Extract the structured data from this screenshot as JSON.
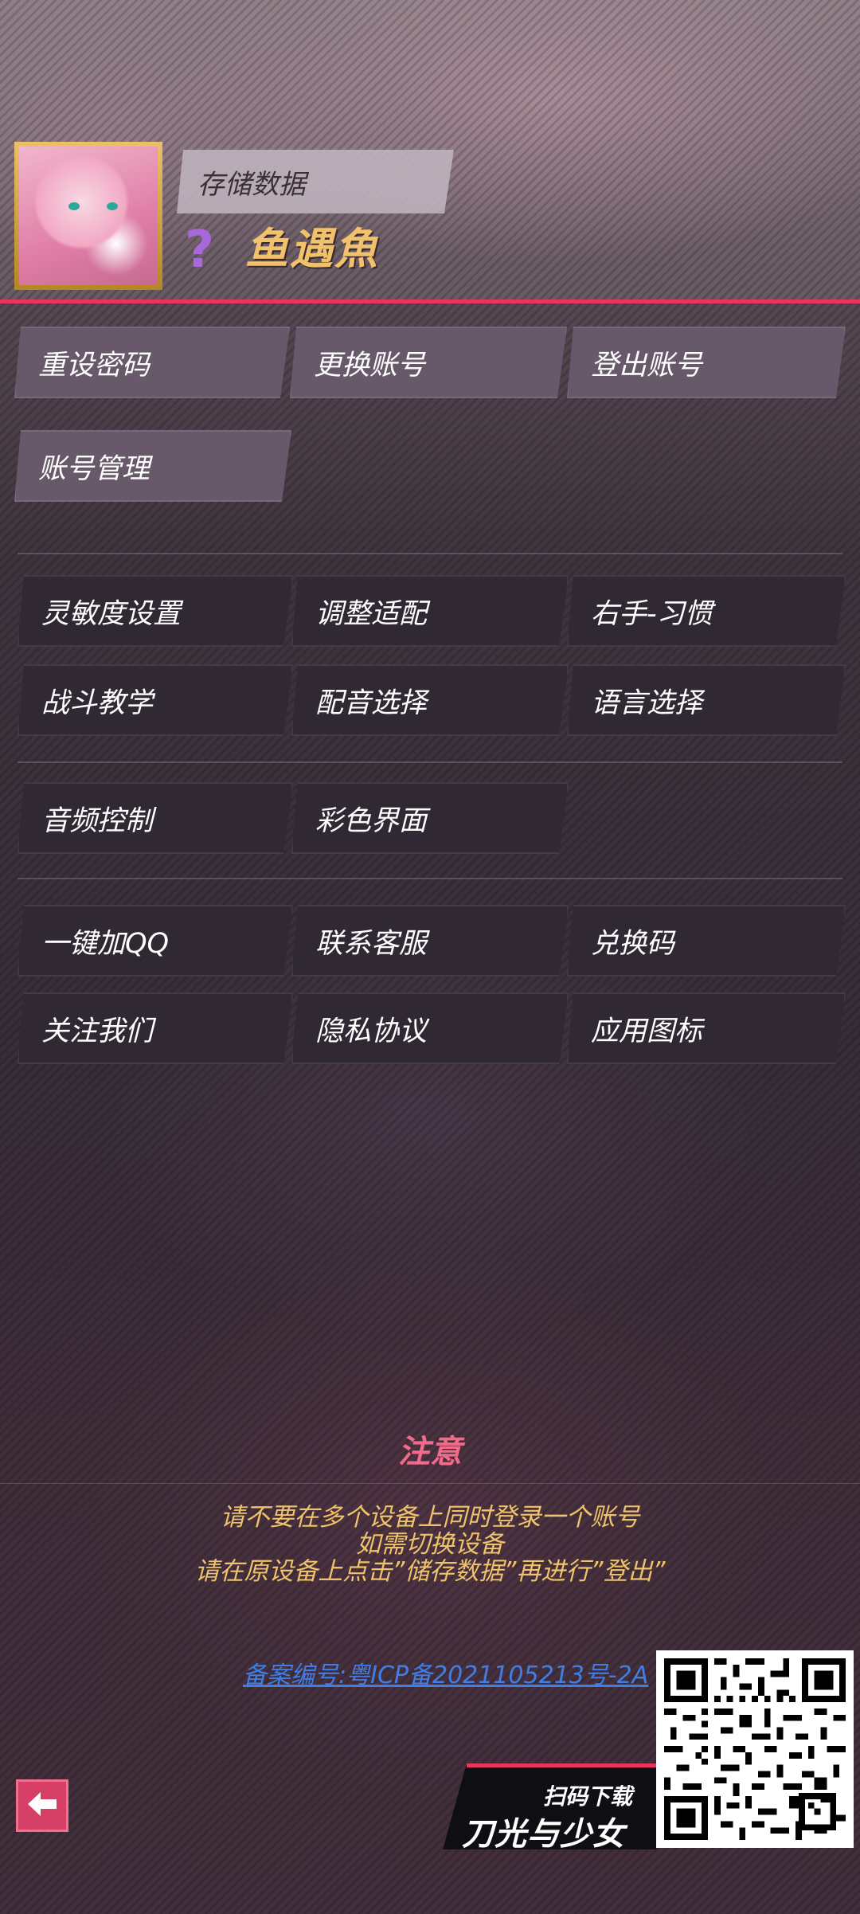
{
  "header": {
    "save_data_label": "存储数据",
    "rank_symbol": "?",
    "username": "鱼遇魚"
  },
  "account_buttons": [
    {
      "label": "重设密码"
    },
    {
      "label": "更换账号"
    },
    {
      "label": "登出账号"
    },
    {
      "label": "账号管理"
    }
  ],
  "settings_buttons": [
    {
      "label": "灵敏度设置"
    },
    {
      "label": "调整适配"
    },
    {
      "label": "右手-习惯"
    },
    {
      "label": "战斗教学"
    },
    {
      "label": "配音选择"
    },
    {
      "label": "语言选择"
    }
  ],
  "display_buttons": [
    {
      "label": "音频控制"
    },
    {
      "label": "彩色界面"
    }
  ],
  "social_buttons": [
    {
      "label": "一键加QQ"
    },
    {
      "label": "联系客服"
    },
    {
      "label": "兑换码"
    },
    {
      "label": "关注我们"
    },
    {
      "label": "隐私协议"
    },
    {
      "label": "应用图标"
    }
  ],
  "notice": {
    "title": "注意",
    "lines": [
      "请不要在多个设备上同时登录一个账号",
      "如需切换设备",
      "请在原设备上点击”储存数据”再进行”登出”"
    ]
  },
  "icp": {
    "text": "备案编号:粤ICP备2021105213号-2A"
  },
  "download": {
    "scan_label": "扫码下载",
    "game_name": "刀光与少女"
  },
  "icons": {
    "back": "back-arrow-icon",
    "rank": "question-mark-icon"
  },
  "colors": {
    "accent": "#e8345e",
    "username": "#f2c16b",
    "notice_title": "#f26b8a",
    "notice_text": "#eec36b",
    "link": "#3f7ee6"
  }
}
